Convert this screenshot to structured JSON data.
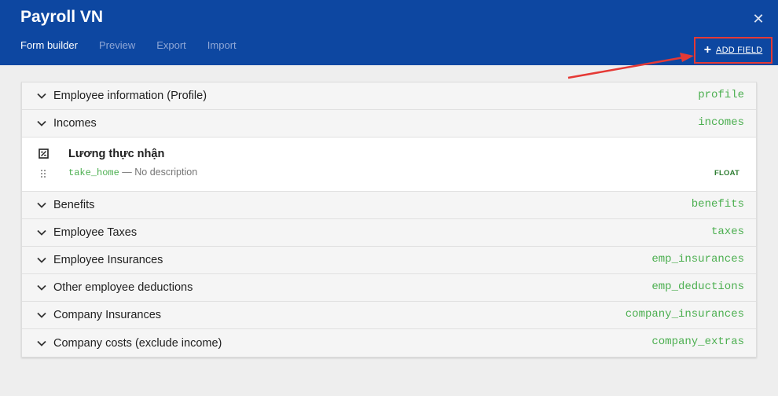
{
  "app": {
    "title": "Payroll VN",
    "close_icon": "close-icon"
  },
  "tabs": [
    {
      "label": "Form builder",
      "active": true
    },
    {
      "label": "Preview",
      "active": false
    },
    {
      "label": "Export",
      "active": false
    },
    {
      "label": "Import",
      "active": false
    }
  ],
  "toolbar": {
    "add_field_label": "ADD FIELD",
    "add_field_icon": "plus-icon"
  },
  "sections": [
    {
      "title": "Employee information (Profile)",
      "key": "profile"
    },
    {
      "title": "Incomes",
      "key": "incomes"
    },
    {
      "title": "Benefits",
      "key": "benefits"
    },
    {
      "title": "Employee Taxes",
      "key": "taxes"
    },
    {
      "title": "Employee Insurances",
      "key": "emp_insurances"
    },
    {
      "title": "Other employee deductions",
      "key": "emp_deductions"
    },
    {
      "title": "Company Insurances",
      "key": "company_insurances"
    },
    {
      "title": "Company costs (exclude income)",
      "key": "company_extras"
    }
  ],
  "field": {
    "name": "Lương thực nhận",
    "code": "take_home",
    "separator": " — ",
    "description": "No description",
    "type": "FLOAT"
  },
  "colors": {
    "header": "#0d47a1",
    "accent_green": "#4caf50",
    "highlight_red": "#e53935",
    "background": "#eeeeee"
  }
}
